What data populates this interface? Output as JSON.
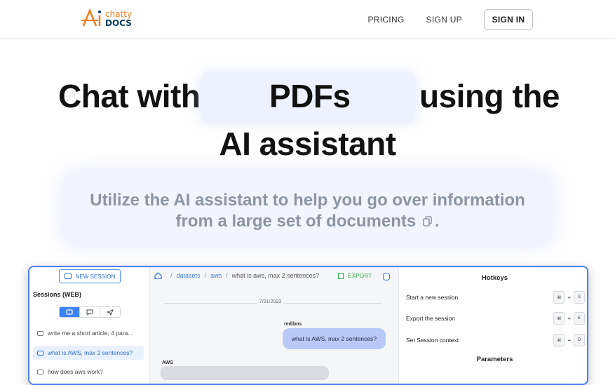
{
  "header": {
    "logo": {
      "top": "chatty",
      "bottom": "DOCS"
    },
    "nav": {
      "pricing": "PRICING",
      "signup": "SIGN UP",
      "signin": "SIGN IN"
    }
  },
  "hero": {
    "w1": "Chat with",
    "w2": "PDFs",
    "w3": "using the",
    "line2": "AI assistant",
    "subtitle_line1": "Utilize the AI assistant to help you go over information",
    "subtitle_line2": "from a large set of documents",
    "subtitle_end": "."
  },
  "app": {
    "new_session": "NEW SESSION",
    "sessions_title": "Sessions (WEB)",
    "sessions": [
      "write me a short article, 4 para...",
      "what is AWS, max 2 sentences?",
      "how does aws work?"
    ],
    "breadcrumb": {
      "datasets": "datasets",
      "aws": "aws",
      "current": "what is aws, max 2 sentences?"
    },
    "export": "EXPORT",
    "date": "7/31/2023",
    "user": "redibos",
    "user_message": "what is AWS, max 2 sentences?",
    "assistant": "AWS",
    "hotkeys_title": "Hotkeys",
    "hotkeys": [
      {
        "label": "Start a new session",
        "k1": "⌘",
        "k2": "S"
      },
      {
        "label": "Export the session",
        "k1": "⌘",
        "k2": "E"
      },
      {
        "label": "Set Session context",
        "k1": "⌘",
        "k2": "D"
      }
    ],
    "parameters_title": "Parameters"
  },
  "colors": {
    "accent": "#3b82f6",
    "logo_orange": "#f07d1a",
    "export_green": "#2eaa4a"
  }
}
